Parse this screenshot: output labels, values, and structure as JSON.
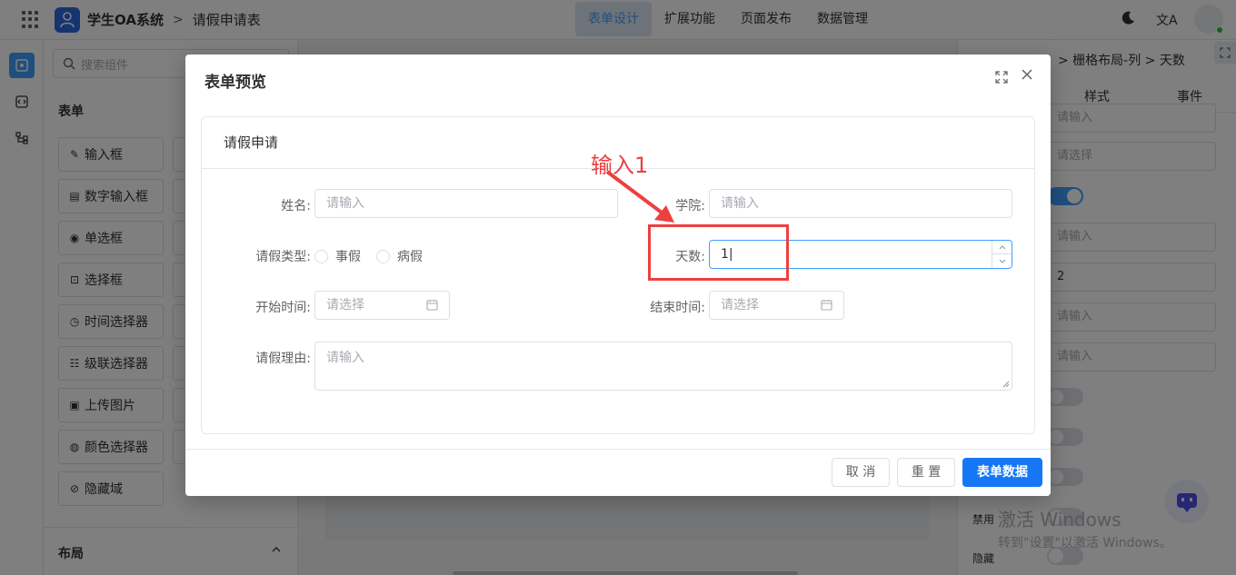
{
  "header": {
    "app_title": "学生OA系统",
    "separator": ">",
    "page_title": "请假申请表",
    "nav": [
      "表单设计",
      "扩展功能",
      "页面发布",
      "数据管理"
    ],
    "active_nav": "表单设计",
    "translate_glyph": "文A"
  },
  "components": {
    "search_placeholder": "搜索组件",
    "section_form": "表单",
    "items": [
      "输入框",
      "数字输入框",
      "单选框",
      "选择框",
      "时间选择器",
      "级联选择器",
      "上传图片",
      "颜色选择器",
      "隐藏域"
    ],
    "section_layout": "布局"
  },
  "properties": {
    "breadcrumb": "> 栅格布局-列 > 天数",
    "tabs": [
      "样式",
      "事件"
    ],
    "fields": [
      "请输入",
      "请选择",
      "请输入",
      "2",
      "请输入",
      "请输入"
    ],
    "label_disabled": "禁用",
    "label_hidden": "隐藏"
  },
  "dialog": {
    "title": "表单预览",
    "form_title": "请假申请",
    "name_label": "姓名:",
    "name_placeholder": "请输入",
    "college_label": "学院:",
    "college_placeholder": "请输入",
    "leave_type_label": "请假类型:",
    "leave_type_options": [
      "事假",
      "病假"
    ],
    "days_label": "天数:",
    "days_value": "1",
    "start_label": "开始时间:",
    "start_placeholder": "请选择",
    "end_label": "结束时间:",
    "end_placeholder": "请选择",
    "reason_label": "请假理由:",
    "reason_placeholder": "请输入",
    "cancel_label": "取 消",
    "reset_label": "重 置",
    "submit_label": "表单数据"
  },
  "annotation": {
    "text": "输入1",
    "color": "#ee3f3f"
  },
  "watermark": {
    "line1": "激活 Windows",
    "line2": "转到\"设置\"以激活 Windows。"
  },
  "colors": {
    "primary": "#1677f5",
    "accent": "#409eff"
  }
}
